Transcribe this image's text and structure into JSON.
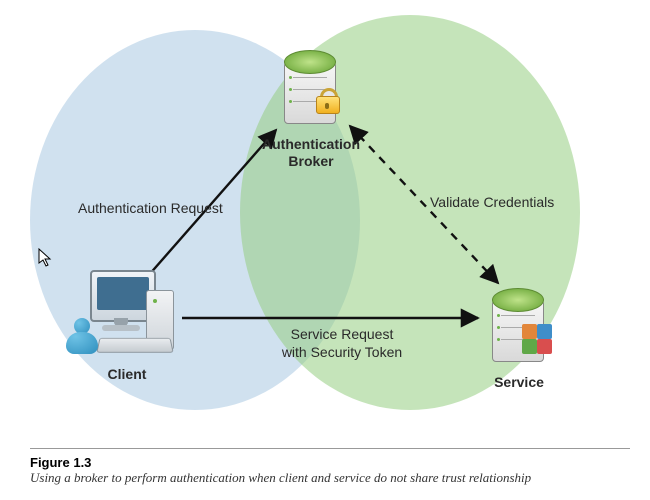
{
  "nodes": {
    "broker": {
      "label": "Authentication\nBroker"
    },
    "client": {
      "label": "Client"
    },
    "service": {
      "label": "Service"
    }
  },
  "edges": {
    "auth_request": {
      "label": "Authentication Request"
    },
    "validate": {
      "label": "Validate Credentials"
    },
    "service_request": {
      "label_line1": "Service Request",
      "label_line2": "with Security Token"
    }
  },
  "caption": {
    "title": "Figure 1.3",
    "text": "Using a broker to perform authentication when client and service do not share trust relationship"
  }
}
